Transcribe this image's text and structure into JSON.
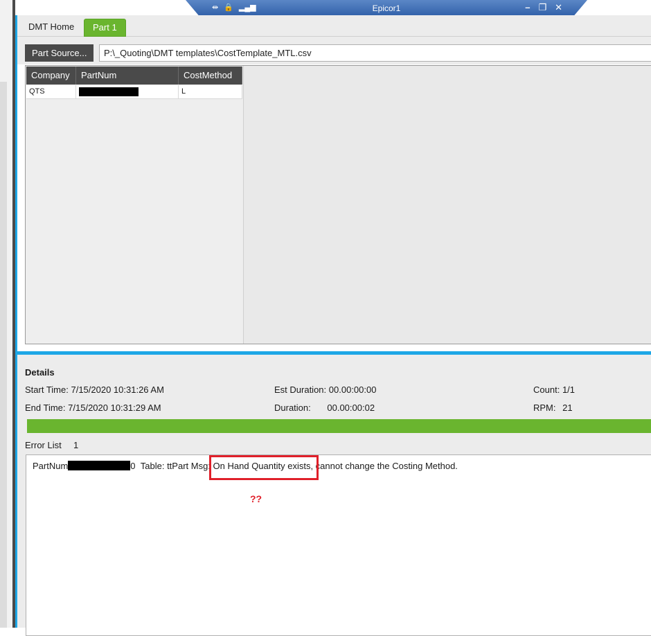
{
  "window": {
    "title": "Epicor1"
  },
  "tabs": [
    {
      "label": "DMT Home"
    },
    {
      "label": "Part 1"
    }
  ],
  "toolbar": {
    "source_button_label": "Part Source...",
    "path_value": "P:\\_Quoting\\DMT templates\\CostTemplate_MTL.csv"
  },
  "grid": {
    "columns": [
      "Company",
      "PartNum",
      "CostMethod"
    ],
    "rows": [
      {
        "company": "QTS",
        "partnum": "",
        "costmethod": "L"
      }
    ]
  },
  "details": {
    "title": "Details",
    "start_time_label": "Start Time:",
    "start_time_value": "7/15/2020 10:31:26 AM",
    "end_time_label": "End Time:",
    "end_time_value": "7/15/2020 10:31:29 AM",
    "est_duration_label": "Est Duration:",
    "est_duration_value": "00.00:00:00",
    "duration_label": "Duration:",
    "duration_value": "00.00:00:02",
    "count_label": "Count:",
    "count_value": "1/1",
    "rpm_label": "RPM:",
    "rpm_value": "21",
    "progress": 1.0
  },
  "errors": {
    "label": "Error List",
    "count": "1",
    "line_prefix": "PartNum",
    "line_suffix_char": "0",
    "line_table": "Table: ttPart Msg:",
    "line_msg": "On Hand Quantity exists, cannot change the Costing Method.",
    "annotation": "??"
  },
  "colors": {
    "accent_blue": "#1ea7e6",
    "tab_green": "#6ab52f",
    "highlight_red": "#e0202a"
  }
}
